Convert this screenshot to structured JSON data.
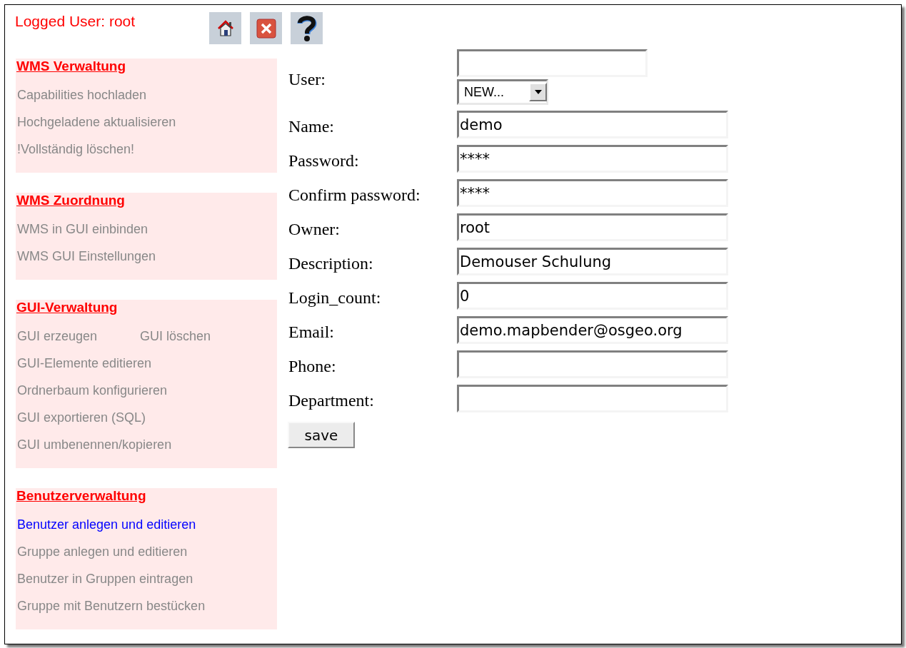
{
  "header": {
    "logged_user": "Logged User: root",
    "toolbar": [
      {
        "kind": "home"
      },
      {
        "kind": "logout"
      },
      {
        "kind": "help"
      }
    ]
  },
  "sidebar": {
    "sections": [
      {
        "title": "WMS Verwaltung",
        "rows": [
          [
            {
              "label": "Capabilities hochladen",
              "selected": false
            }
          ],
          [
            {
              "label": "Hochgeladene aktualisieren",
              "selected": false
            }
          ],
          [
            {
              "label": "!Vollständig löschen!",
              "selected": false
            }
          ]
        ]
      },
      {
        "title": "WMS Zuordnung",
        "rows": [
          [
            {
              "label": "WMS in GUI einbinden",
              "selected": false
            }
          ],
          [
            {
              "label": "WMS GUI Einstellungen",
              "selected": false
            }
          ]
        ]
      },
      {
        "title": "GUI-Verwaltung",
        "rows": [
          [
            {
              "label": "GUI erzeugen",
              "selected": false
            },
            {
              "label": "GUI löschen",
              "selected": false
            }
          ],
          [
            {
              "label": "GUI-Elemente editieren",
              "selected": false
            }
          ],
          [
            {
              "label": "Ordnerbaum konfigurieren",
              "selected": false
            }
          ],
          [
            {
              "label": "GUI exportieren (SQL)",
              "selected": false
            }
          ],
          [
            {
              "label": "GUI umbenennen/kopieren",
              "selected": false
            }
          ]
        ]
      },
      {
        "title": "Benutzerverwaltung",
        "rows": [
          [
            {
              "label": "Benutzer anlegen und editieren",
              "selected": true
            }
          ],
          [
            {
              "label": "Gruppe anlegen und editieren",
              "selected": false
            }
          ],
          [
            {
              "label": "Benutzer in Gruppen eintragen",
              "selected": false
            }
          ],
          [
            {
              "label": "Gruppe mit Benutzern bestücken",
              "selected": false
            }
          ]
        ]
      }
    ]
  },
  "form": {
    "fields": [
      {
        "kind": "user",
        "label": "User:",
        "select_value": "NEW..."
      },
      {
        "kind": "text",
        "label": "Name:",
        "value": "demo"
      },
      {
        "kind": "text",
        "label": "Password:",
        "value": "****"
      },
      {
        "kind": "text",
        "label": "Confirm password:",
        "value": "****"
      },
      {
        "kind": "text",
        "label": "Owner:",
        "value": "root"
      },
      {
        "kind": "text",
        "label": "Description:",
        "value": "Demouser Schulung"
      },
      {
        "kind": "text",
        "label": "Login_count:",
        "value": "0"
      },
      {
        "kind": "text",
        "label": "Email:",
        "value": "demo.mapbender@osgeo.org"
      },
      {
        "kind": "text",
        "label": "Phone:"
      },
      {
        "kind": "text",
        "label": "Department:"
      }
    ],
    "save_button": "save"
  }
}
